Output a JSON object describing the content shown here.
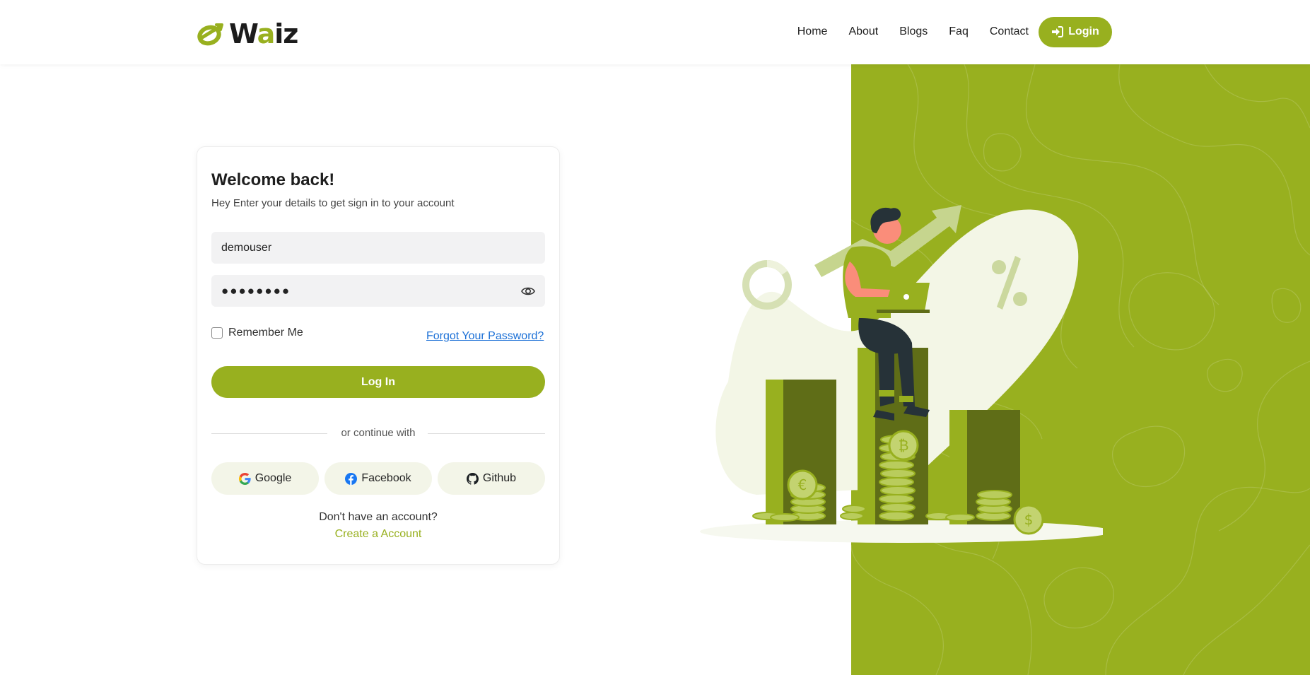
{
  "header": {
    "logo": {
      "prefix": "W",
      "accent": "a",
      "suffix": "iz"
    },
    "nav": [
      "Home",
      "About",
      "Blogs",
      "Faq",
      "Contact"
    ],
    "login_button": "Login"
  },
  "login_form": {
    "title": "Welcome back!",
    "subtitle": "Hey Enter your details to get sign in to your account",
    "username_value": "demouser",
    "password_value": "●●●●●●●●",
    "remember_label": "Remember Me",
    "forgot_link": "Forgot Your Password?",
    "submit_label": "Log In",
    "divider_text": "or continue with",
    "social": [
      {
        "label": "Google",
        "icon": "google-icon"
      },
      {
        "label": "Facebook",
        "icon": "facebook-icon"
      },
      {
        "label": "Github",
        "icon": "github-icon"
      }
    ],
    "no_account_text": "Don't have an account?",
    "create_account_link": "Create a Account"
  },
  "colors": {
    "accent": "#98b01f",
    "link": "#1a6fd6",
    "input_bg": "#f2f2f3",
    "social_bg": "#f3f5e8"
  }
}
